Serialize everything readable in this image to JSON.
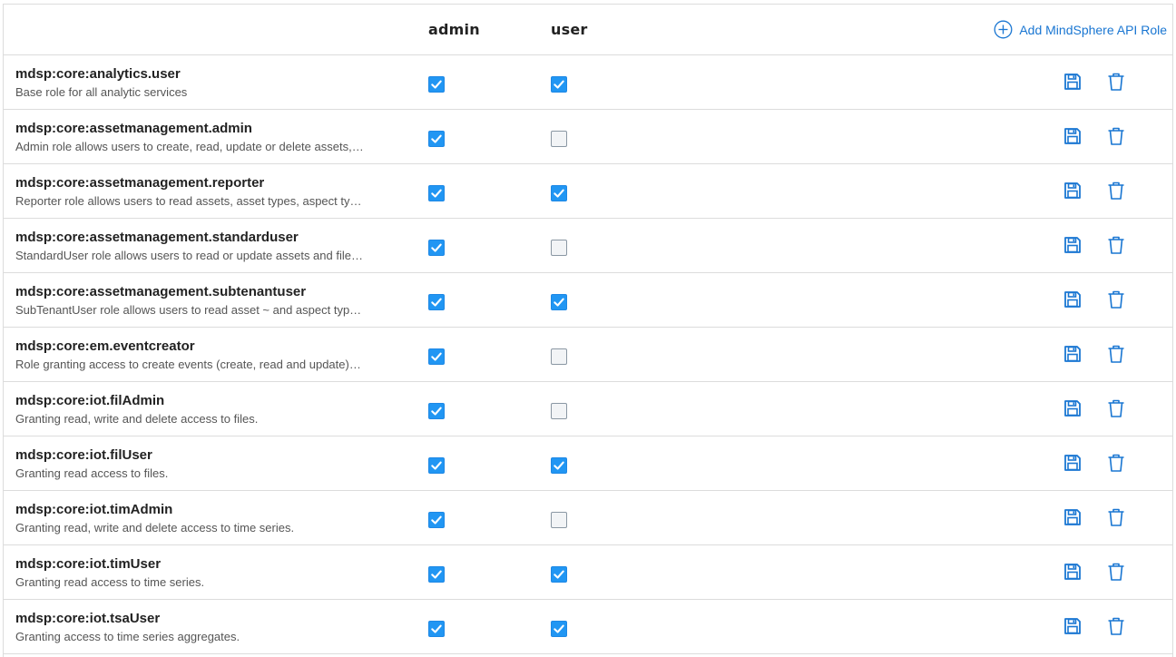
{
  "header": {
    "columns": {
      "admin": "admin",
      "user": "user"
    },
    "add_role_label": "Add MindSphere API Role"
  },
  "colors": {
    "accent": "#1976d2",
    "checked": "#2196f3",
    "border": "#dcdcdc"
  },
  "roles": [
    {
      "name": "mdsp:core:analytics.user",
      "description": "Base role for all analytic services",
      "admin": true,
      "user": true
    },
    {
      "name": "mdsp:core:assetmanagement.admin",
      "description": "Admin role allows users to create, read, update or delete assets,…",
      "admin": true,
      "user": false
    },
    {
      "name": "mdsp:core:assetmanagement.reporter",
      "description": "Reporter role allows users to read assets, asset types, aspect ty…",
      "admin": true,
      "user": true
    },
    {
      "name": "mdsp:core:assetmanagement.standarduser",
      "description": "StandardUser role allows users to read or update assets and file…",
      "admin": true,
      "user": false
    },
    {
      "name": "mdsp:core:assetmanagement.subtenantuser",
      "description": "SubTenantUser role allows users to read asset ~ and aspect typ…",
      "admin": true,
      "user": true
    },
    {
      "name": "mdsp:core:em.eventcreator",
      "description": "Role granting access to create events (create, read and update)…",
      "admin": true,
      "user": false
    },
    {
      "name": "mdsp:core:iot.filAdmin",
      "description": "Granting read, write and delete access to files.",
      "admin": true,
      "user": false
    },
    {
      "name": "mdsp:core:iot.filUser",
      "description": "Granting read access to files.",
      "admin": true,
      "user": true
    },
    {
      "name": "mdsp:core:iot.timAdmin",
      "description": "Granting read, write and delete access to time series.",
      "admin": true,
      "user": false
    },
    {
      "name": "mdsp:core:iot.timUser",
      "description": "Granting read access to time series.",
      "admin": true,
      "user": true
    },
    {
      "name": "mdsp:core:iot.tsaUser",
      "description": "Granting access to time series aggregates.",
      "admin": true,
      "user": true
    }
  ],
  "icons": {
    "add": "plus-circle-icon",
    "save": "save-icon",
    "delete": "trash-icon",
    "check": "checkmark-icon"
  }
}
